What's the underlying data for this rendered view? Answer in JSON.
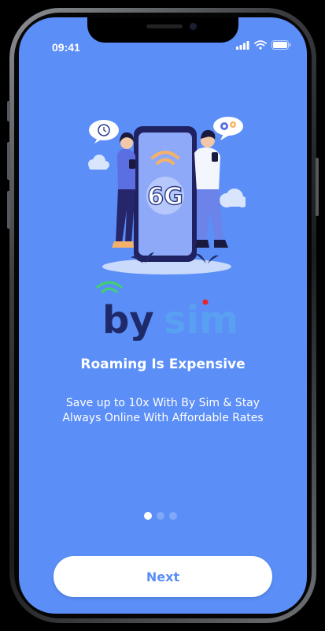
{
  "status_bar": {
    "time": "09:41"
  },
  "logo": {
    "part1": "by",
    "part2": "sim"
  },
  "onboarding": {
    "title": "Roaming Is Expensive",
    "subtitle": "Save up to 10x With By Sim & Stay Always Online With Affordable Rates",
    "illustration_badge": "6G",
    "page_indicator": {
      "total": 3,
      "active": 1
    }
  },
  "actions": {
    "next_label": "Next"
  },
  "colors": {
    "background": "#5b8ef7",
    "brand_dark": "#1f2a6b",
    "brand_light": "#5aa0f2",
    "button_text": "#5b8ef7"
  }
}
